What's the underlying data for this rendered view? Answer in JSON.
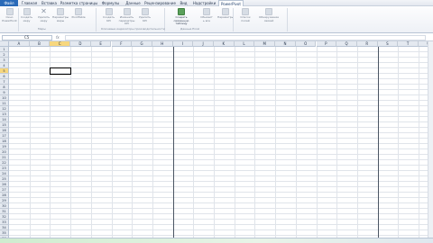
{
  "ribbon_tabs": [
    {
      "label": "Файл",
      "kind": "file"
    },
    {
      "label": "Главная",
      "kind": "normal"
    },
    {
      "label": "Вставка",
      "kind": "normal"
    },
    {
      "label": "Разметка страницы",
      "kind": "normal"
    },
    {
      "label": "Формулы",
      "kind": "normal"
    },
    {
      "label": "Данные",
      "kind": "normal"
    },
    {
      "label": "Рецензирование",
      "kind": "normal"
    },
    {
      "label": "Вид",
      "kind": "normal"
    },
    {
      "label": "Надстройки",
      "kind": "normal"
    },
    {
      "label": "PowerPivot",
      "kind": "active"
    }
  ],
  "window_controls": {
    "help": "?",
    "minimize": "−",
    "restore": "❐",
    "close": "✕"
  },
  "ribbon_buttons": [
    {
      "label": "Окно\nPowerPivot",
      "icon": "powerpivot-window-icon",
      "style": "dim"
    },
    {
      "label": "Создать\nмеру",
      "icon": "new-measure-icon",
      "style": "dim"
    },
    {
      "label": "Удалить\nмеру",
      "icon": "delete-measure-icon",
      "style": "x"
    },
    {
      "label": "Параметры\nмеры",
      "icon": "measure-settings-icon",
      "style": "dim"
    },
    {
      "label": "PivotTable",
      "icon": "pivottable-icon",
      "style": "dim"
    },
    {
      "label": "Создать\nKPI",
      "icon": "new-kpi-icon",
      "style": "dim"
    },
    {
      "label": "Изменить\nпараметры KPI",
      "icon": "edit-kpi-icon",
      "style": "dim"
    },
    {
      "label": "Удалить\nKPI",
      "icon": "delete-kpi-icon",
      "style": "dim"
    },
    {
      "label": "Создать\nсвязанную таблицу",
      "icon": "linked-table-icon",
      "style": "accent"
    },
    {
      "label": "Обновит\nь все",
      "icon": "refresh-all-icon",
      "style": "dim"
    },
    {
      "label": "Параметры",
      "icon": "parameters-icon",
      "style": "dim"
    },
    {
      "label": "Список\nполей",
      "icon": "field-list-icon",
      "style": "dim"
    },
    {
      "label": "Обнаружение\nсвязей",
      "icon": "detect-relationships-icon",
      "style": "dim"
    }
  ],
  "ribbon_groups": [
    {
      "label": "Меры"
    },
    {
      "label": "Ключевые индикаторы производительности"
    },
    {
      "label": "Данные Excel"
    }
  ],
  "formula_bar": {
    "name_box": "C5",
    "fx_label": "fx",
    "formula": ""
  },
  "columns": [
    "A",
    "B",
    "C",
    "D",
    "E",
    "F",
    "G",
    "H",
    "I",
    "J",
    "K",
    "L",
    "M",
    "N",
    "O",
    "P",
    "Q",
    "R",
    "S",
    "T",
    "U"
  ],
  "rows": [
    "1",
    "2",
    "3",
    "4",
    "5",
    "6",
    "7",
    "8",
    "9",
    "10",
    "11",
    "12",
    "13",
    "14",
    "15",
    "16",
    "17",
    "18",
    "19",
    "20",
    "21",
    "22",
    "23",
    "24",
    "25",
    "26",
    "27",
    "28",
    "29",
    "30",
    "31",
    "32",
    "33",
    "34",
    "35",
    "36"
  ],
  "active_cell": {
    "column": "C",
    "row": "5"
  },
  "page_break_after_columns": [
    "H",
    "R"
  ],
  "colors": {
    "file_tab": "#2a6ab8",
    "selected_header": "#f7d77e",
    "page_break": "#4b5563"
  }
}
